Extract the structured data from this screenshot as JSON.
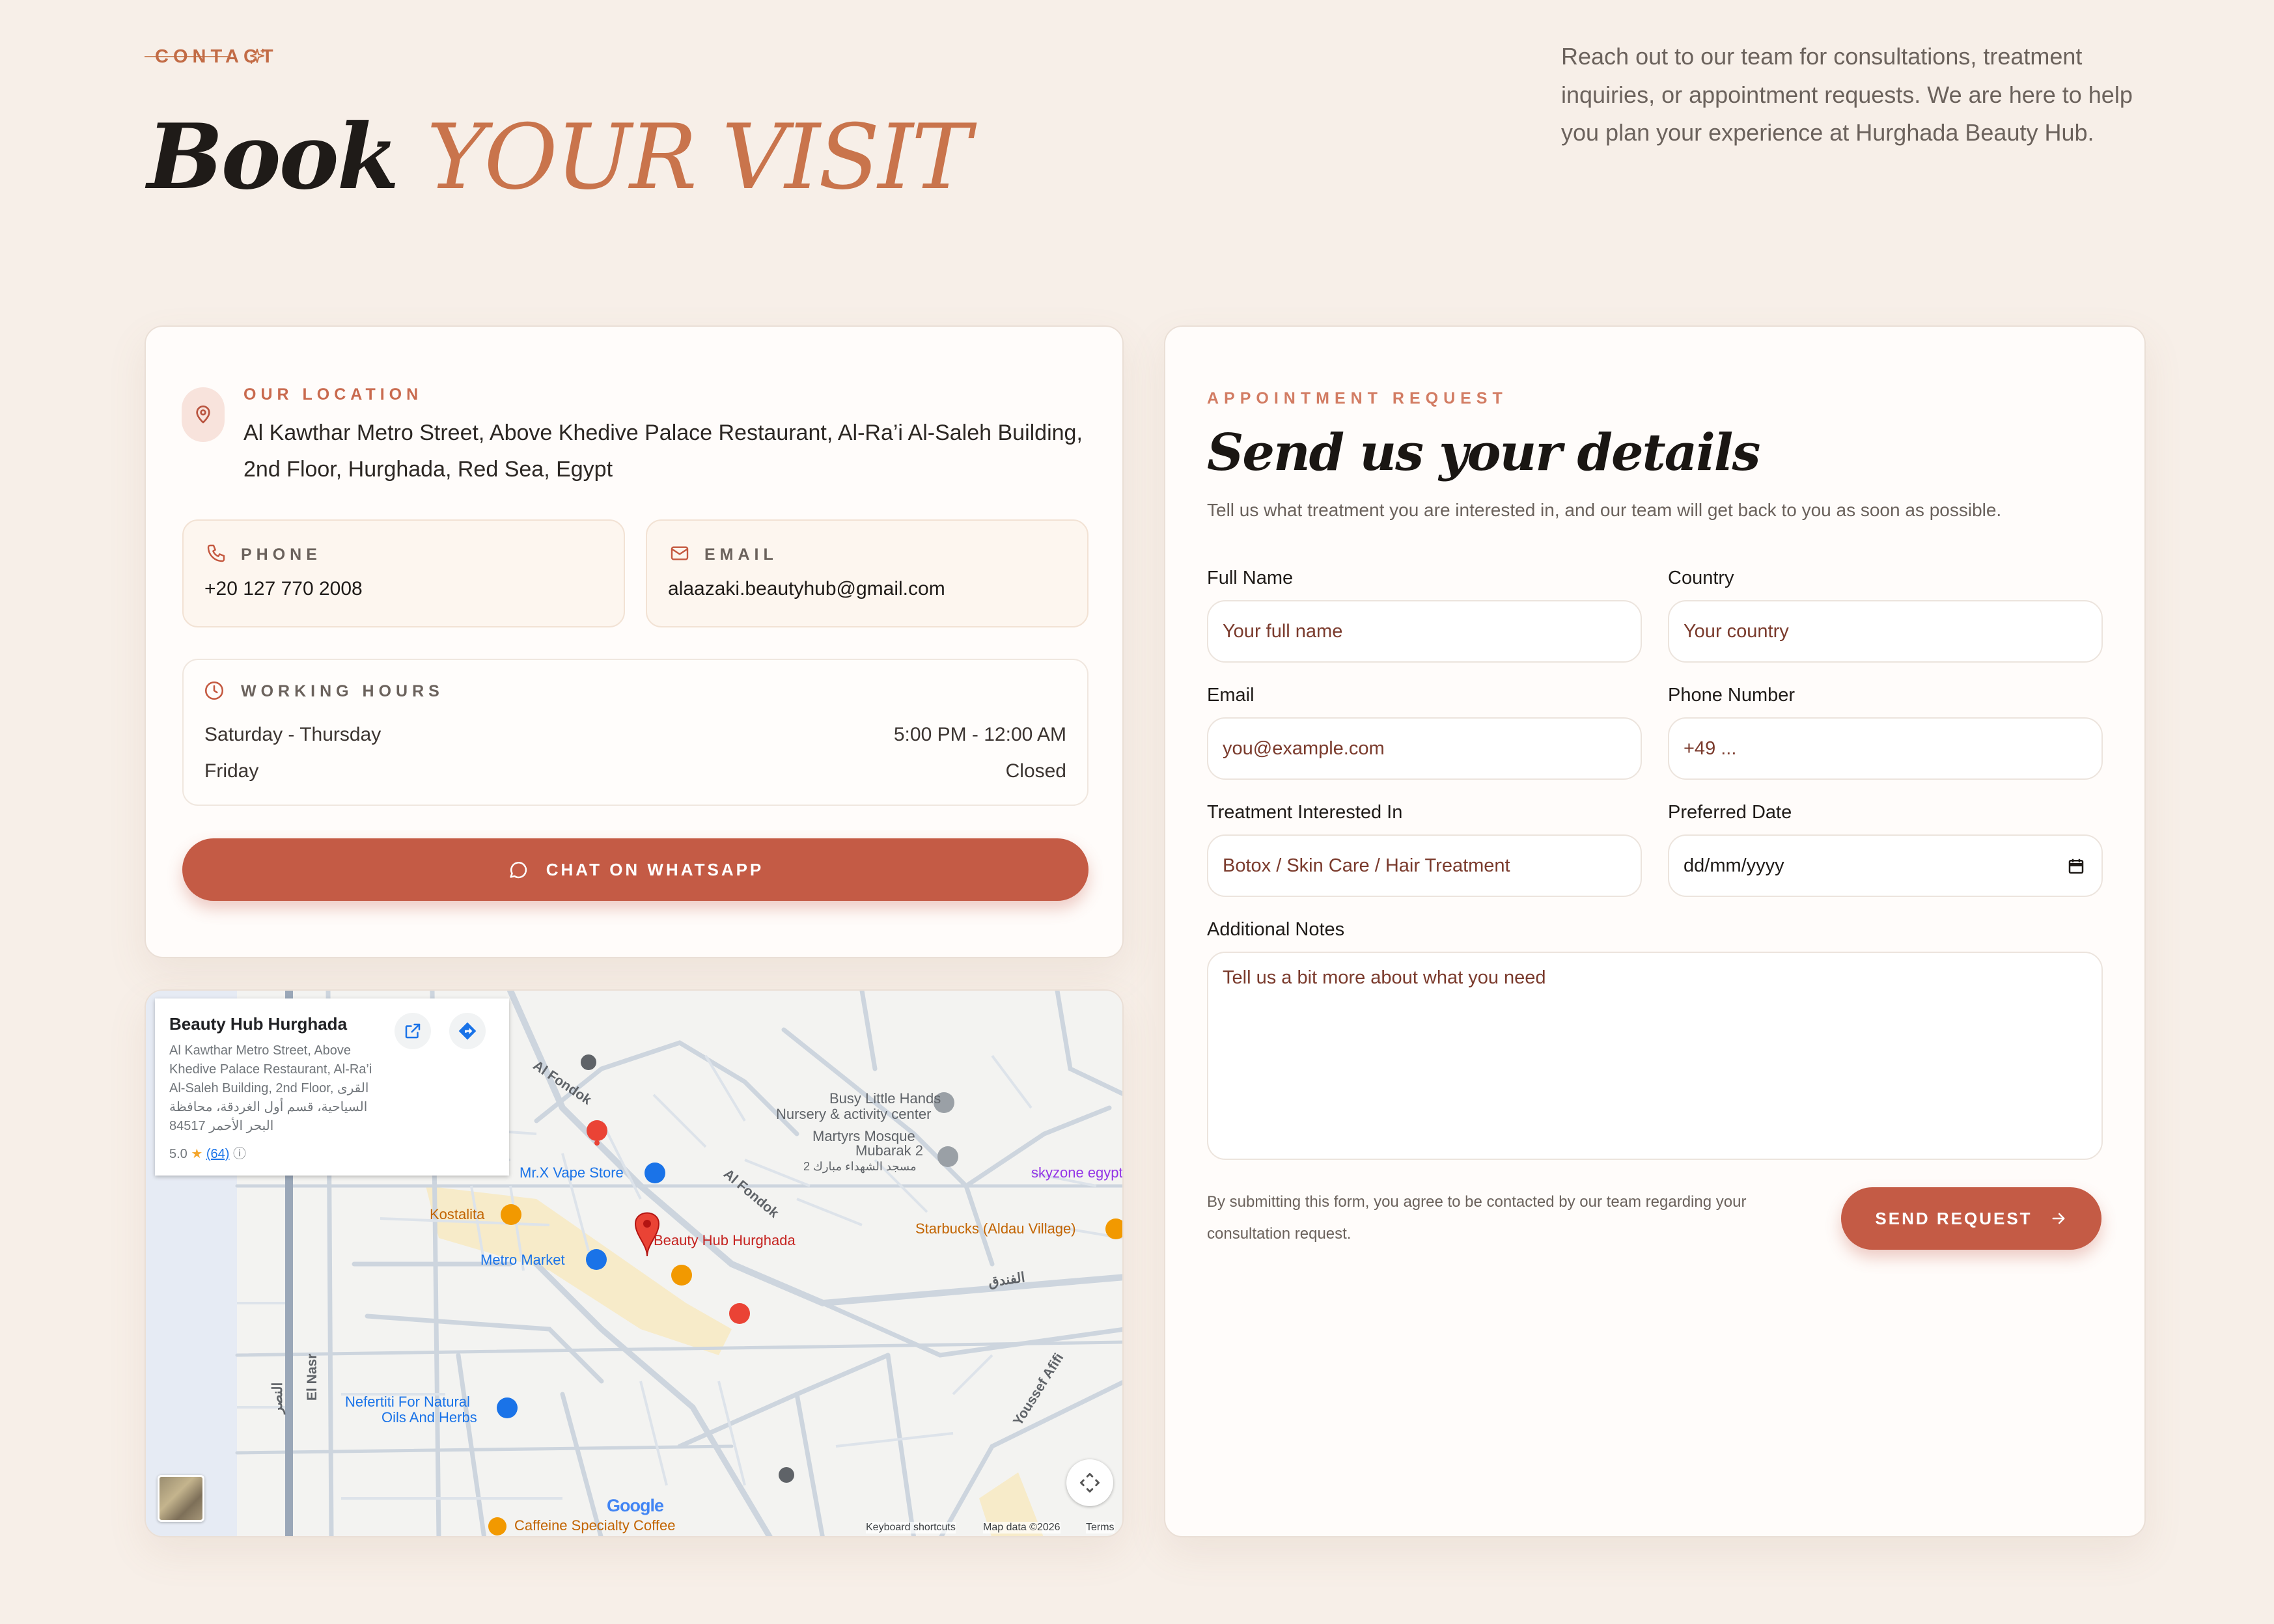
{
  "header": {
    "eyebrow": "CONTACT",
    "title_strong": "Book",
    "title_accent": "YOUR VISIT",
    "intro": "Reach out to our team for consultations, treatment inquiries, or appointment requests. We are here to help you plan your experience at Hurghada Beauty Hub."
  },
  "location": {
    "heading": "OUR LOCATION",
    "address": "Al Kawthar Metro Street, Above Khedive Palace Restaurant, Al-Ra’i Al-Saleh Building, 2nd Floor, Hurghada, Red Sea, Egypt",
    "phone_label": "PHONE",
    "phone": "+20 127 770 2008",
    "email_label": "EMAIL",
    "email": "alaazaki.beautyhub@gmail.com",
    "hours_label": "WORKING HOURS",
    "hours": [
      {
        "days": "Saturday - Thursday",
        "time": "5:00 PM - 12:00 AM"
      },
      {
        "days": "Friday",
        "time": "Closed"
      }
    ],
    "whatsapp_label": "CHAT ON WHATSAPP"
  },
  "map": {
    "place_name": "Beauty Hub Hurghada",
    "place_address": "Al Kawthar Metro Street, Above Khedive Palace Restaurant, Al-Ra’i Al-Saleh Building, 2nd Floor, القرى السياحية، قسم أول الغردقة، محافظة البحر الأحمر 84517",
    "rating": "5.0",
    "rating_count": "(64)",
    "labels": {
      "beauty_hub": "Beauty Hub Hurghada",
      "busy_little": "Busy Little Hands",
      "nursery": "Nursery & activity center",
      "martyrs": "Martyrs Mosque",
      "mubarak": "Mubarak 2",
      "arabic_mosque": "مسجد الشهداء مبارك 2",
      "mrx": "Mr.X Vape Store",
      "skyzone": "skyzone egypt",
      "kostalita": "Kostalita",
      "starbucks": "Starbucks (Aldau Village)",
      "metro": "Metro Market",
      "nefertiti1": "Nefertiti For Natural",
      "nefertiti2": "Oils And Herbs",
      "caffeine": "Caffeine Specialty Coffee",
      "fondok1": "Al Fondok",
      "fondok2": "Al Fondok",
      "fondok_ar": "الفندق",
      "elnasr": "El Nasr",
      "elnasr_ar": "النصر",
      "youssef": "Youssef Afifi",
      "google": "Google",
      "kb": "Keyboard shortcuts",
      "mapdata": "Map data ©2026",
      "terms": "Terms"
    }
  },
  "form": {
    "eyebrow": "APPOINTMENT REQUEST",
    "title": "Send us your details",
    "subtitle": "Tell us what treatment you are interested in, and our team will get back to you as soon as possible.",
    "full_name_label": "Full Name",
    "full_name_placeholder": "Your full name",
    "country_label": "Country",
    "country_placeholder": "Your country",
    "email_label": "Email",
    "email_placeholder": "you@example.com",
    "phone_label": "Phone Number",
    "phone_placeholder": "+49 ...",
    "treatment_label": "Treatment Interested In",
    "treatment_placeholder": "Botox / Skin Care / Hair Treatment",
    "date_label": "Preferred Date",
    "date_placeholder": "dd/mm/yyyy",
    "notes_label": "Additional Notes",
    "notes_placeholder": "Tell us a bit more about what you need",
    "disclaimer": "By submitting this form, you agree to be contacted by our team regarding your consultation request.",
    "submit_label": "SEND REQUEST"
  },
  "colors": {
    "background": "#f7efe8",
    "accent": "#c45b45",
    "accent_text": "#c9744c",
    "card": "#fffcfa"
  }
}
